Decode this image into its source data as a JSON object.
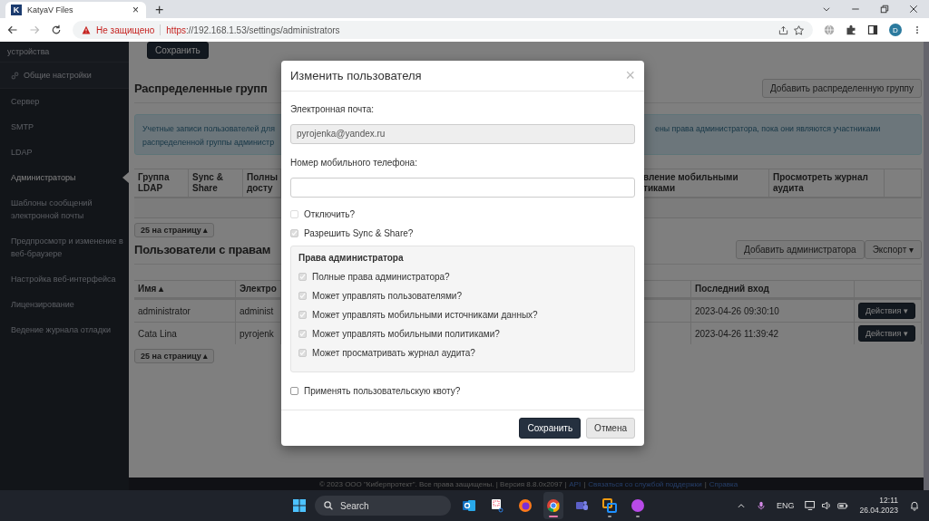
{
  "browser": {
    "tab_title": "KatyaV Files",
    "tab_logo": "K",
    "tab_close": "×",
    "new_tab": "+",
    "security": "Не защищено",
    "url_scheme": "https",
    "url_rest": "://192.168.1.53/settings/administrators",
    "avatar": "D"
  },
  "sidebar": {
    "items": [
      {
        "label": "устройства",
        "kind": "section",
        "selected": false
      },
      {
        "label": "Общие настройки",
        "kind": "section",
        "selected": false
      },
      {
        "label": "Сервер",
        "kind": "item",
        "selected": false
      },
      {
        "label": "SMTP",
        "kind": "item",
        "selected": false
      },
      {
        "label": "LDAP",
        "kind": "item",
        "selected": false
      },
      {
        "label": "Администраторы",
        "kind": "item",
        "selected": true
      },
      {
        "label": "Шаблоны сообщений электронной почты",
        "kind": "item",
        "selected": false
      },
      {
        "label": "Предпросмотр и изменение в веб-браузере",
        "kind": "item",
        "selected": false
      },
      {
        "label": "Настройка веб-интерфейса",
        "kind": "item",
        "selected": false
      },
      {
        "label": "Лицензирование",
        "kind": "item",
        "selected": false
      },
      {
        "label": "Ведение журнала отладки",
        "kind": "item",
        "selected": false
      }
    ]
  },
  "top_button": "Сохранить",
  "groups": {
    "title": "Распределенные групп",
    "add_button": "Добавить распределенную группу",
    "info_left": "Учетные записи пользователей для распределенной группы администр",
    "info_right": "ены права администратора, пока они являются участниками",
    "columns": [
      "Группа LDAP",
      "Sync & Share",
      "Полны досту",
      "вление мобильными тиками",
      "Просмотреть журнал аудита"
    ],
    "pager": "25 на страницу ▴"
  },
  "admins": {
    "title": "Пользователи с правам",
    "add_button": "Добавить администратора",
    "export_button": "Экспорт ▾",
    "columns": [
      "Имя ▴",
      "Электро",
      "Последний вход"
    ],
    "rows": [
      {
        "name": "administrator",
        "email": "administ",
        "last_login": "2023-04-26 09:30:10",
        "action": "Действия ▾"
      },
      {
        "name": "Cata Lina",
        "email": "pyrojenk",
        "last_login": "2023-04-26 11:39:42",
        "action": "Действия ▾"
      }
    ],
    "pager": "25 на страницу ▴"
  },
  "footer": {
    "parts": [
      {
        "kind": "text",
        "text": "© 2023 ООО \"Киберпротект\". Все права защищены. | Версия 8.8.0x2097 |"
      },
      {
        "kind": "link",
        "text": "API"
      },
      {
        "kind": "text",
        "text": "|"
      },
      {
        "kind": "link",
        "text": "Связаться со службой поддержки"
      },
      {
        "kind": "text",
        "text": "|"
      },
      {
        "kind": "link",
        "text": "Справка"
      }
    ]
  },
  "modal": {
    "title": "Изменить пользователя",
    "close": "×",
    "email_label": "Электронная почта:",
    "email_value": "pyrojenka@yandex.ru",
    "phone_label": "Номер мобильного телефона:",
    "checkboxes": [
      {
        "label": "Отключить?",
        "checked": false,
        "disabled": true
      },
      {
        "label": "Разрешить Sync & Share?",
        "checked": true,
        "disabled": true
      }
    ],
    "permissions": {
      "title": "Права администратора",
      "items": [
        {
          "label": "Полные права администратора?",
          "checked": true,
          "disabled": true
        },
        {
          "label": "Может управлять пользователями?",
          "checked": true,
          "disabled": true
        },
        {
          "label": "Может управлять мобильными источниками данных?",
          "checked": true,
          "disabled": true
        },
        {
          "label": "Может управлять мобильными политиками?",
          "checked": true,
          "disabled": true
        },
        {
          "label": "Может просматривать журнал аудита?",
          "checked": true,
          "disabled": true
        }
      ]
    },
    "quota": {
      "label": "Применять пользовательскую квоту?",
      "checked": false,
      "disabled": false
    },
    "save_button": "Сохранить",
    "cancel_button": "Отмена"
  },
  "taskbar": {
    "search": "Search",
    "apps": [
      {
        "kind": "outlook",
        "selected": false,
        "running": false
      },
      {
        "kind": "snipping",
        "selected": false,
        "running": false
      },
      {
        "kind": "firefox",
        "selected": false,
        "running": false
      },
      {
        "kind": "chrome",
        "selected": true,
        "running": true
      },
      {
        "kind": "teams",
        "selected": false,
        "running": false
      },
      {
        "kind": "vmware",
        "selected": false,
        "running": true
      },
      {
        "kind": "circle",
        "selected": false,
        "running": true
      }
    ],
    "language": "ENG",
    "time": "12:11",
    "date": "26.04.2023"
  }
}
